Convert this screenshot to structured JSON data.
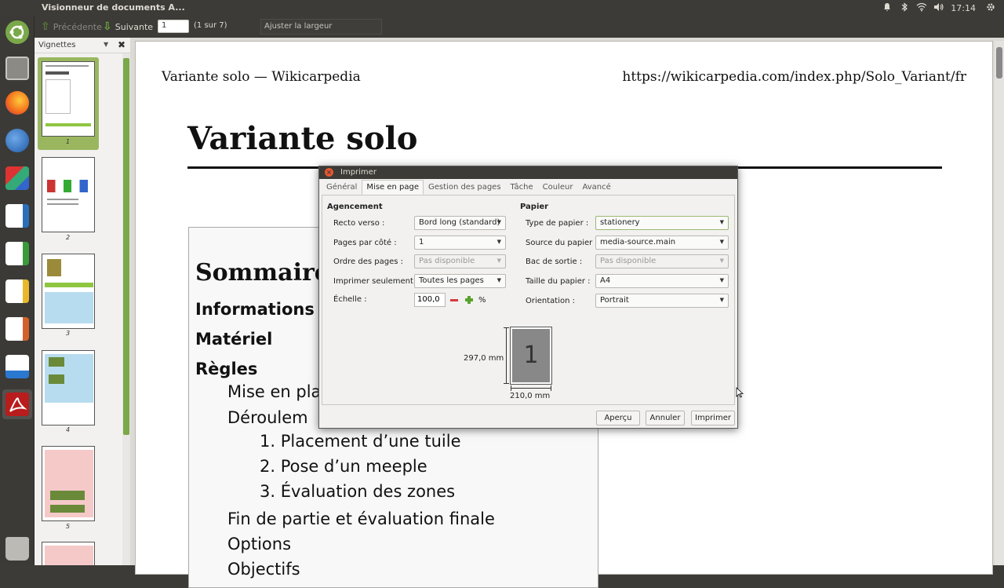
{
  "window": {
    "title": "Visionneur de documents A..."
  },
  "tray": {
    "bell_icon": "bell-icon",
    "bluetooth_icon": "bluetooth-icon",
    "wifi_icon": "wifi-icon",
    "volume_icon": "volume-icon",
    "clock": "17:14",
    "gear_icon": "gear-icon"
  },
  "toolbar": {
    "prev_label": "Précédente",
    "next_label": "Suivante",
    "page_value": "1",
    "page_of": "(1 sur 7)",
    "zoom_label": "Ajuster la largeur"
  },
  "sidebar": {
    "title": "Vignettes",
    "thumbnails": [
      "1",
      "2",
      "3",
      "4",
      "5"
    ]
  },
  "document": {
    "header_left": "Variante solo — Wikicarpedia",
    "header_right": "https://wikicarpedia.com/index.php/Solo_Variant/fr",
    "title": "Variante solo",
    "toc_title": "Sommaire",
    "toc": {
      "informations": "Informations",
      "materiel": "Matériel",
      "regles": "Règles",
      "mise_en_place": "Mise en pla",
      "deroulement": "Déroulem",
      "placement": "1. Placement d’une tuile",
      "pose": "2. Pose d’un meeple",
      "evaluation": "3. Évaluation des zones",
      "fin": "Fin de partie et évaluation finale",
      "options": "Options",
      "objectifs": "Objectifs"
    }
  },
  "dialog": {
    "title": "Imprimer",
    "tabs": [
      "Général",
      "Mise en page",
      "Gestion des pages",
      "Tâche",
      "Couleur",
      "Avancé"
    ],
    "agencement": {
      "title": "Agencement",
      "recto_label": "Recto verso :",
      "recto_value": "Bord long (standard)",
      "pages_label": "Pages par côté :",
      "pages_value": "1",
      "ordre_label": "Ordre des pages :",
      "ordre_value": "Pas disponible",
      "imprimer_label": "Imprimer seulement :",
      "imprimer_value": "Toutes les pages",
      "echelle_label": "Échelle :",
      "echelle_value": "100,0",
      "percent": "%"
    },
    "papier": {
      "title": "Papier",
      "type_label": "Type de papier :",
      "type_value": "stationery",
      "source_label": "Source du papier :",
      "source_value": "media-source.main",
      "bac_label": "Bac de sortie :",
      "bac_value": "Pas disponible",
      "taille_label": "Taille du papier :",
      "taille_value": "A4",
      "orientation_label": "Orientation :",
      "orientation_value": "Portrait"
    },
    "preview": {
      "page_number": "1",
      "height": "297,0 mm",
      "width": "210,0 mm"
    },
    "buttons": {
      "apercu": "Aperçu",
      "annuler": "Annuler",
      "imprimer": "Imprimer"
    }
  }
}
